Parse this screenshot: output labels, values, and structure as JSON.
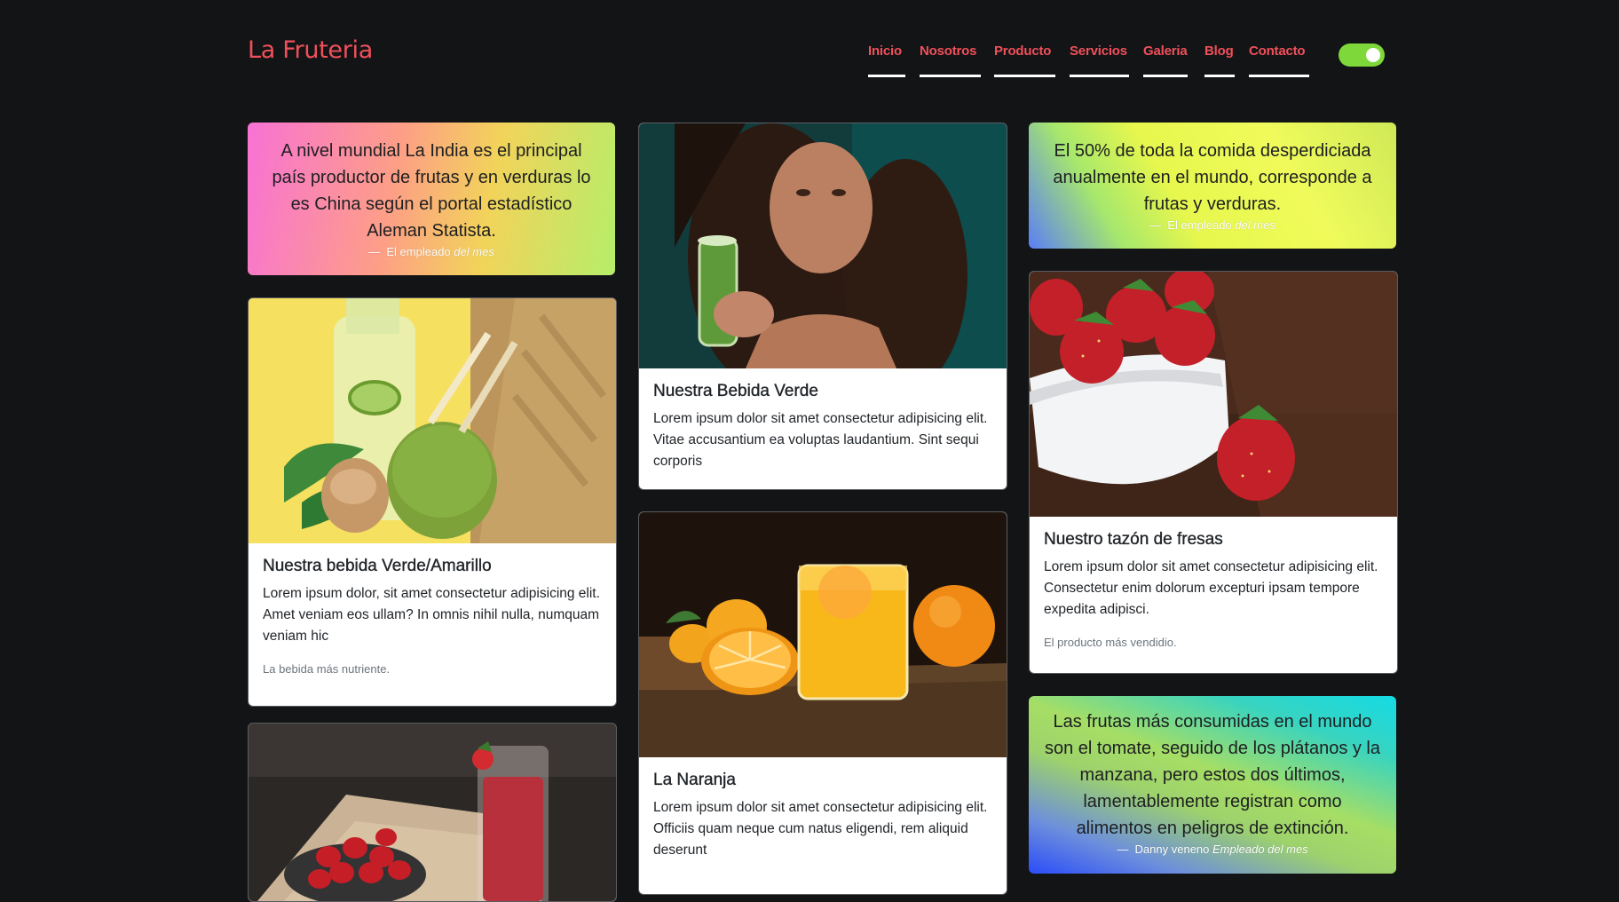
{
  "brand": "La Fruteria",
  "nav": {
    "items": [
      {
        "label": "Inicio"
      },
      {
        "label": "Nosotros"
      },
      {
        "label": "Producto"
      },
      {
        "label": "Servicios"
      },
      {
        "label": "Galeria"
      },
      {
        "label": "Blog"
      },
      {
        "label": "Contacto"
      }
    ]
  },
  "theme_toggle": {
    "state": "on",
    "color": "#7fd83a"
  },
  "colors": {
    "accent": "#f0505a",
    "background": "#131416"
  },
  "quotes": [
    {
      "text": "A nivel mundial La India es el principal país productor de frutas y en verduras lo es China según el portal estadístico Aleman Statista.",
      "author": "El empleado",
      "cite": "del mes"
    },
    {
      "text": "El 50% de toda la comida desperdiciada anualmente en el mundo, corresponde a frutas y verduras.",
      "author": "El empleado",
      "cite": "del mes"
    },
    {
      "text": "Las frutas más consumidas en el mundo son el tomate, seguido de los plátanos y la manzana, pero estos dos últimos, lamentablemente registran como alimentos en peligros de extinción.",
      "author": "Danny veneno",
      "cite": "Empleado del mes"
    }
  ],
  "cards": [
    {
      "title": "Nuestra bebida Verde/Amarillo",
      "text": "Lorem ipsum dolor, sit amet consectetur adipisicing elit. Amet veniam eos ullam? In omnis nihil nulla, numquam veniam hic",
      "footer": "La bebida más nutriente."
    },
    {
      "title": "Nuestra Bebida Verde",
      "text": "Lorem ipsum dolor sit amet consectetur adipisicing elit. Vitae accusantium ea voluptas laudantium. Sint sequi corporis"
    },
    {
      "title": "Nuestro tazón de fresas",
      "text": "Lorem ipsum dolor sit amet consectetur adipisicing elit. Consectetur enim dolorum excepturi ipsam tempore expedita adipisci.",
      "footer": "El producto más vendidio."
    },
    {
      "title": "La Naranja",
      "text": "Lorem ipsum dolor sit amet consectetur adipisicing elit. Officiis quam neque cum natus eligendi, rem aliquid deserunt"
    }
  ]
}
